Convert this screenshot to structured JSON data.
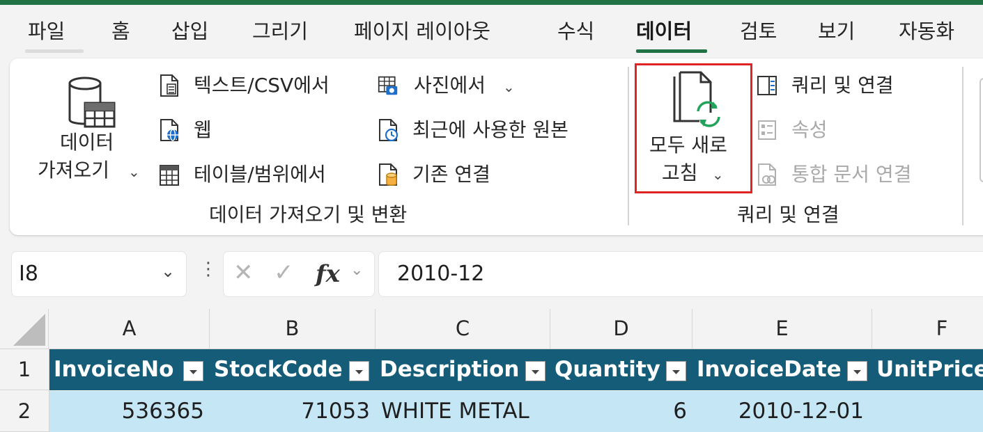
{
  "tabs": [
    "파일",
    "홈",
    "삽입",
    "그리기",
    "페이지 레이아웃",
    "수식",
    "데이터",
    "검토",
    "보기",
    "자동화"
  ],
  "active_tab": "데이터",
  "colors": {
    "accent": "#217346",
    "highlight": "#e02424",
    "table_header": "#145c78",
    "table_row": "#c5e6f5"
  },
  "ribbon": {
    "get_data": {
      "line1": "데이터",
      "line2": "가져오기"
    },
    "from_text_csv": "텍스트/CSV에서",
    "web": "웹",
    "from_table_range": "테이블/범위에서",
    "from_picture": "사진에서",
    "recent_sources": "최근에 사용한 원본",
    "existing_connections": "기존 연결",
    "group_get_transform": "데이터 가져오기 및 변환",
    "refresh_all": {
      "line1": "모두 새로",
      "line2": "고침"
    },
    "queries_connections": "쿼리 및 연결",
    "properties": "속성",
    "workbook_links": "통합 문서 연결",
    "group_queries": "쿼리 및 연결"
  },
  "formula_bar": {
    "name_box": "I8",
    "fx": "fx",
    "formula": "2010-12"
  },
  "sheet": {
    "columns": [
      "A",
      "B",
      "C",
      "D",
      "E",
      "F"
    ],
    "rows": [
      "1",
      "2"
    ],
    "headers": [
      "InvoiceNo",
      "StockCode",
      "Description",
      "Quantity",
      "InvoiceDate",
      "UnitPrice"
    ],
    "row2": [
      "536365",
      "71053",
      "WHITE METAL",
      "6",
      "2010-12-01",
      ""
    ]
  }
}
